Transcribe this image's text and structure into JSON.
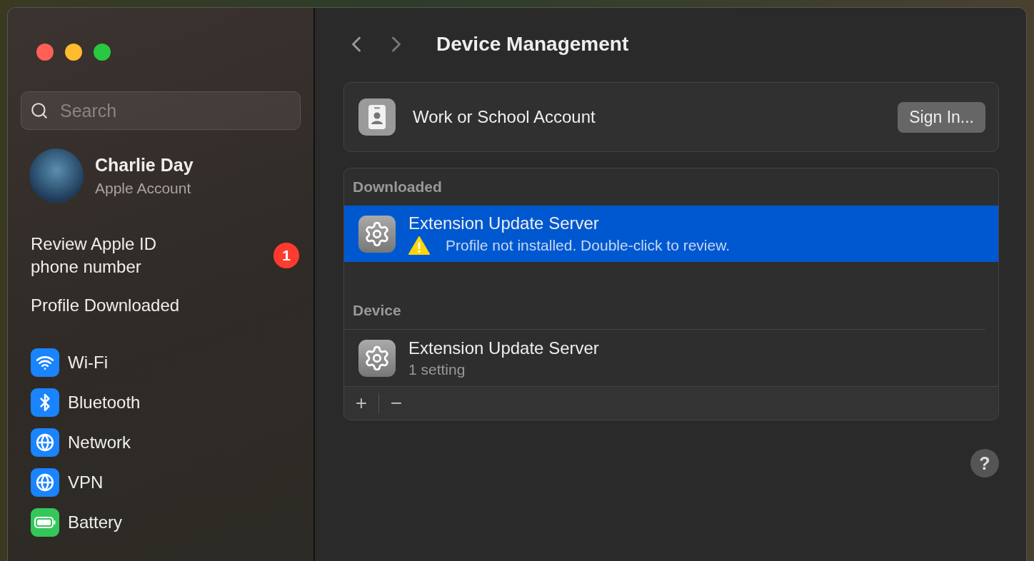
{
  "window": {
    "title": "Device Management"
  },
  "sidebar": {
    "search": {
      "placeholder": "Search"
    },
    "account": {
      "name": "Charlie Day",
      "subtitle": "Apple Account"
    },
    "notices": [
      {
        "label": "Review Apple ID\nphone number",
        "badge": "1"
      },
      {
        "label": "Profile Downloaded"
      }
    ],
    "items": [
      {
        "label": "Wi-Fi",
        "color": "#1a84ff"
      },
      {
        "label": "Bluetooth",
        "color": "#1a84ff"
      },
      {
        "label": "Network",
        "color": "#1a84ff"
      },
      {
        "label": "VPN",
        "color": "#1a84ff"
      },
      {
        "label": "Battery",
        "color": "#34c759"
      }
    ]
  },
  "account_card": {
    "label": "Work or School Account",
    "button": "Sign In..."
  },
  "profiles": {
    "sections": [
      {
        "title": "Downloaded",
        "rows": [
          {
            "name": "Extension Update Server",
            "detail": "Profile not installed. Double-click to review.",
            "kind": "warning",
            "selected": true
          }
        ]
      },
      {
        "title": "Device",
        "rows": [
          {
            "name": "Extension Update Server",
            "detail": "1 setting",
            "kind": "plain",
            "selected": false
          }
        ]
      }
    ],
    "add": "+",
    "remove": "−"
  },
  "help": "?"
}
